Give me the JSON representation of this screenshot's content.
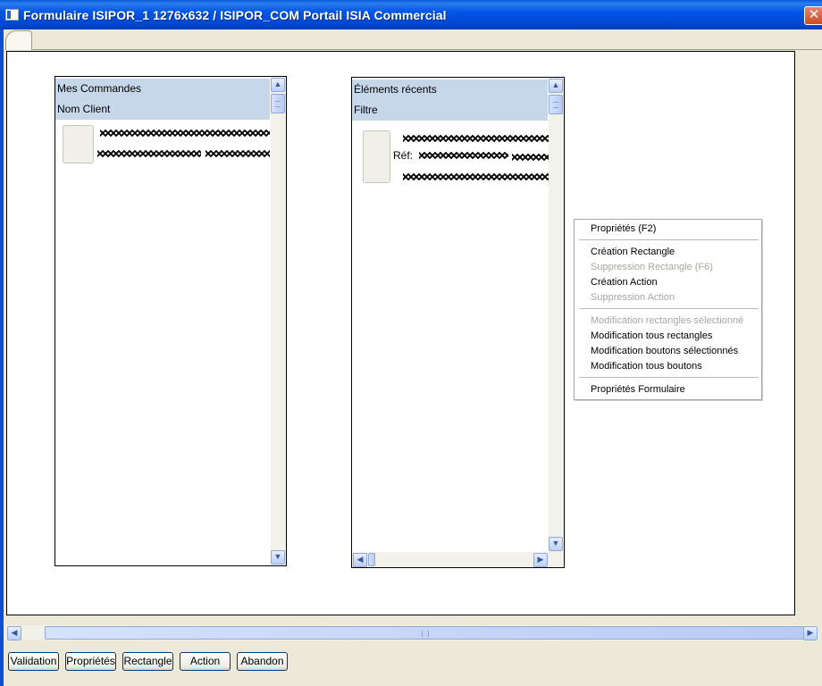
{
  "window": {
    "title": "Formulaire ISIPOR_1 1276x632 / ISIPOR_COM Portail ISIA Commercial",
    "close_glyph": "✕"
  },
  "icons": {
    "app": "window-app-icon",
    "close": "close-icon",
    "up": "arrow-up-icon",
    "down": "arrow-down-icon",
    "left": "arrow-left-icon",
    "right": "arrow-right-icon"
  },
  "glyphs": {
    "up": "▲",
    "down": "▼",
    "left": "◀",
    "right": "▶"
  },
  "panel_commandes": {
    "title": "Mes Commandes",
    "subtitle": "Nom Client"
  },
  "panel_recents": {
    "title": "Éléments récents",
    "subtitle": "Filtre",
    "ref_label": "Réf:"
  },
  "context_menu": {
    "items": [
      {
        "label": "Propriétés (F2)",
        "enabled": true
      },
      {
        "label": "Création Rectangle",
        "enabled": true
      },
      {
        "label": "Suppression Rectangle (F6)",
        "enabled": false
      },
      {
        "label": "Création Action",
        "enabled": true
      },
      {
        "label": "Suppression Action",
        "enabled": false
      },
      {
        "label": "Modification rectangles sélectionné",
        "enabled": false
      },
      {
        "label": "Modification tous rectangles",
        "enabled": true
      },
      {
        "label": "Modification boutons sélectionnés",
        "enabled": true
      },
      {
        "label": "Modification tous boutons",
        "enabled": true
      },
      {
        "label": "Propriétés Formulaire",
        "enabled": true
      }
    ]
  },
  "buttons": {
    "validation": "Validation",
    "proprietes": "Propriétés",
    "rectangle": "Rectangle",
    "action": "Action",
    "abandon": "Abandon"
  },
  "colors": {
    "titlebar": "#0055e5",
    "panel_header": "#c6d7ea",
    "disabled_text": "#a7a6a0",
    "window_bg": "#ece9d8"
  }
}
